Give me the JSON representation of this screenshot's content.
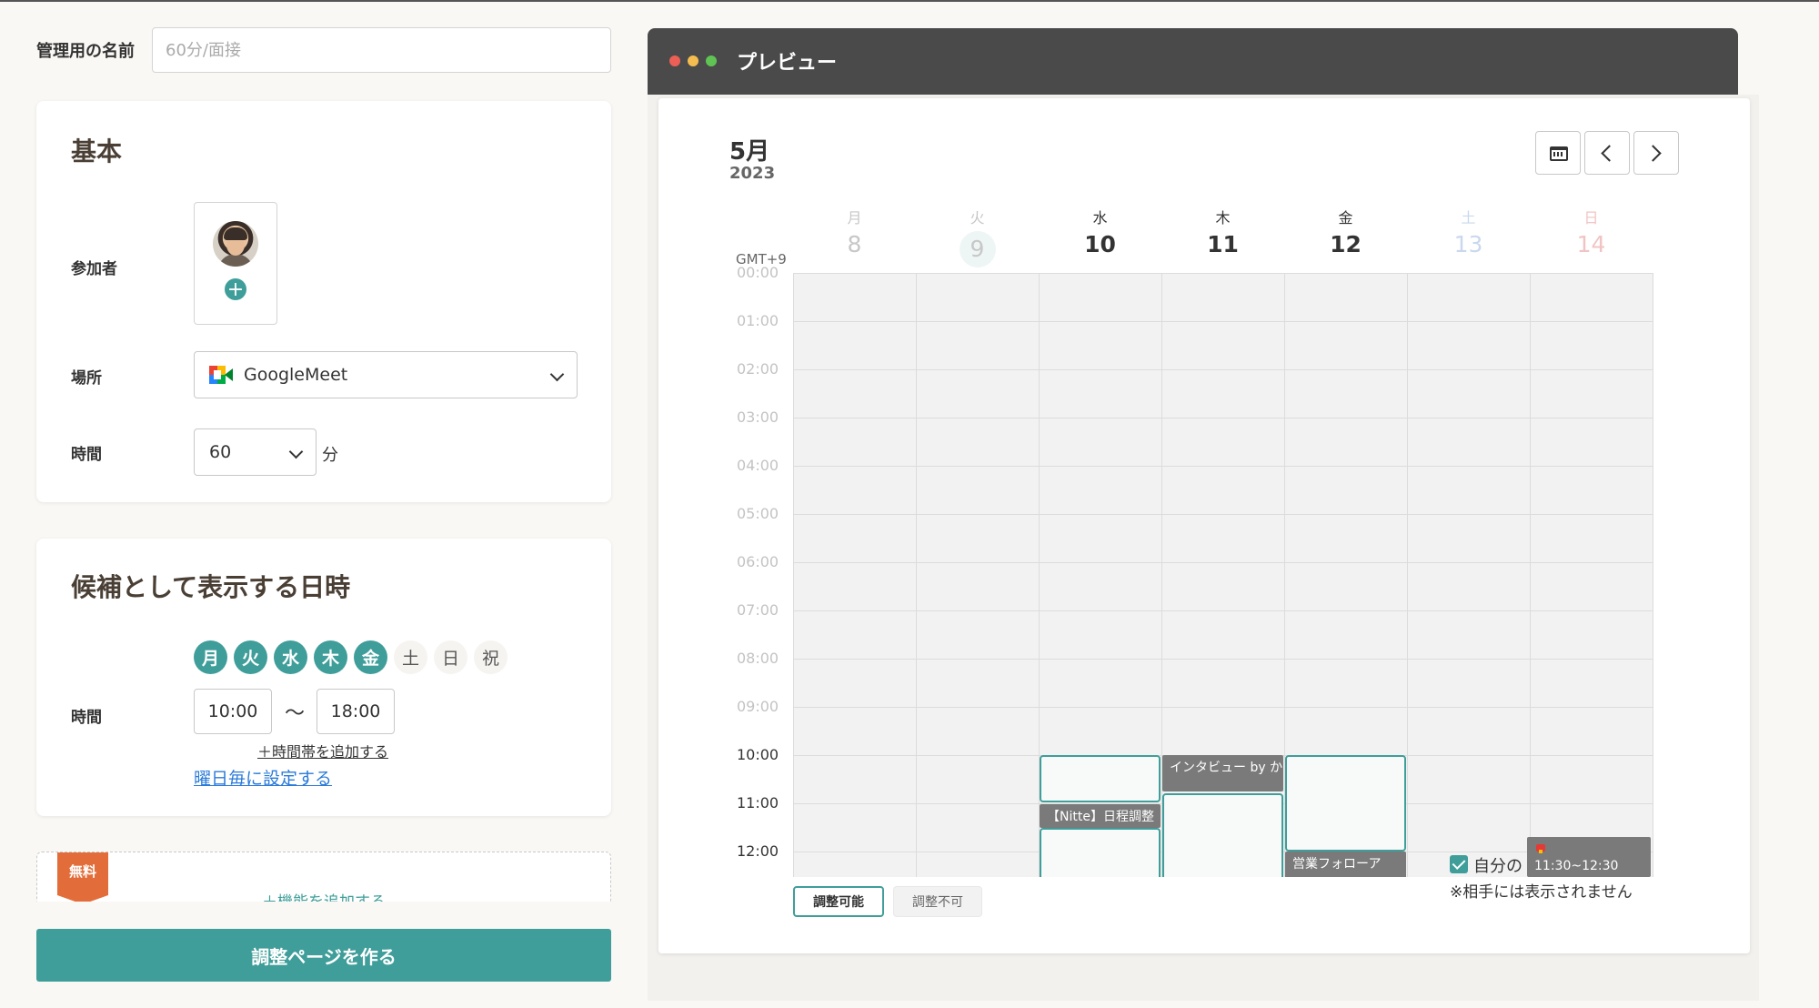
{
  "form": {
    "admin_name_label": "管理用の名前",
    "admin_name_placeholder": "60分/面接",
    "basic": {
      "title": "基本",
      "participants_label": "参加者",
      "location_label": "場所",
      "location_value": "GoogleMeet",
      "duration_label": "時間",
      "duration_value": "60",
      "duration_unit": "分"
    },
    "candidates": {
      "title": "候補として表示する日時",
      "days": [
        {
          "label": "月",
          "on": true
        },
        {
          "label": "火",
          "on": true
        },
        {
          "label": "水",
          "on": true
        },
        {
          "label": "木",
          "on": true
        },
        {
          "label": "金",
          "on": true
        },
        {
          "label": "土",
          "on": false
        },
        {
          "label": "日",
          "on": false
        },
        {
          "label": "祝",
          "on": false
        }
      ],
      "time_label": "時間",
      "start": "10:00",
      "tilde": "〜",
      "end": "18:00",
      "add_slot": "＋時間帯を追加する",
      "per_weekday": "曜日毎に設定する"
    },
    "feature": {
      "tag": "無料",
      "add": "＋機能を追加する"
    },
    "create_button": "調整ページを作る"
  },
  "preview": {
    "title": "プレビュー",
    "window_dots": [
      "#ec5f56",
      "#f4bd4f",
      "#5fc454"
    ],
    "month": "5月",
    "year": "2023",
    "timezone": "GMT+9",
    "days": [
      {
        "name": "月",
        "num": "8",
        "state": "past"
      },
      {
        "name": "火",
        "num": "9",
        "state": "today"
      },
      {
        "name": "水",
        "num": "10",
        "state": "normal"
      },
      {
        "name": "木",
        "num": "11",
        "state": "normal"
      },
      {
        "name": "金",
        "num": "12",
        "state": "normal"
      },
      {
        "name": "土",
        "num": "13",
        "state": "sat"
      },
      {
        "name": "日",
        "num": "14",
        "state": "sun"
      }
    ],
    "hours": [
      "00:00",
      "01:00",
      "02:00",
      "03:00",
      "04:00",
      "05:00",
      "06:00",
      "07:00",
      "08:00",
      "09:00",
      "10:00",
      "11:00",
      "12:00"
    ],
    "events": [
      {
        "label": "インタビュー by かずうちんばっ",
        "day": 3
      },
      {
        "label": "【Nitte】日程調整",
        "day": 2
      },
      {
        "label": "営業フォローア",
        "day": 4
      }
    ],
    "legend_available": "調整可能",
    "legend_unavailable": "調整不可",
    "own_label": "自分の",
    "own_event_time": "11:30~12:30",
    "own_note": "※相手には表示されません",
    "accent": "#3f9e9a"
  }
}
